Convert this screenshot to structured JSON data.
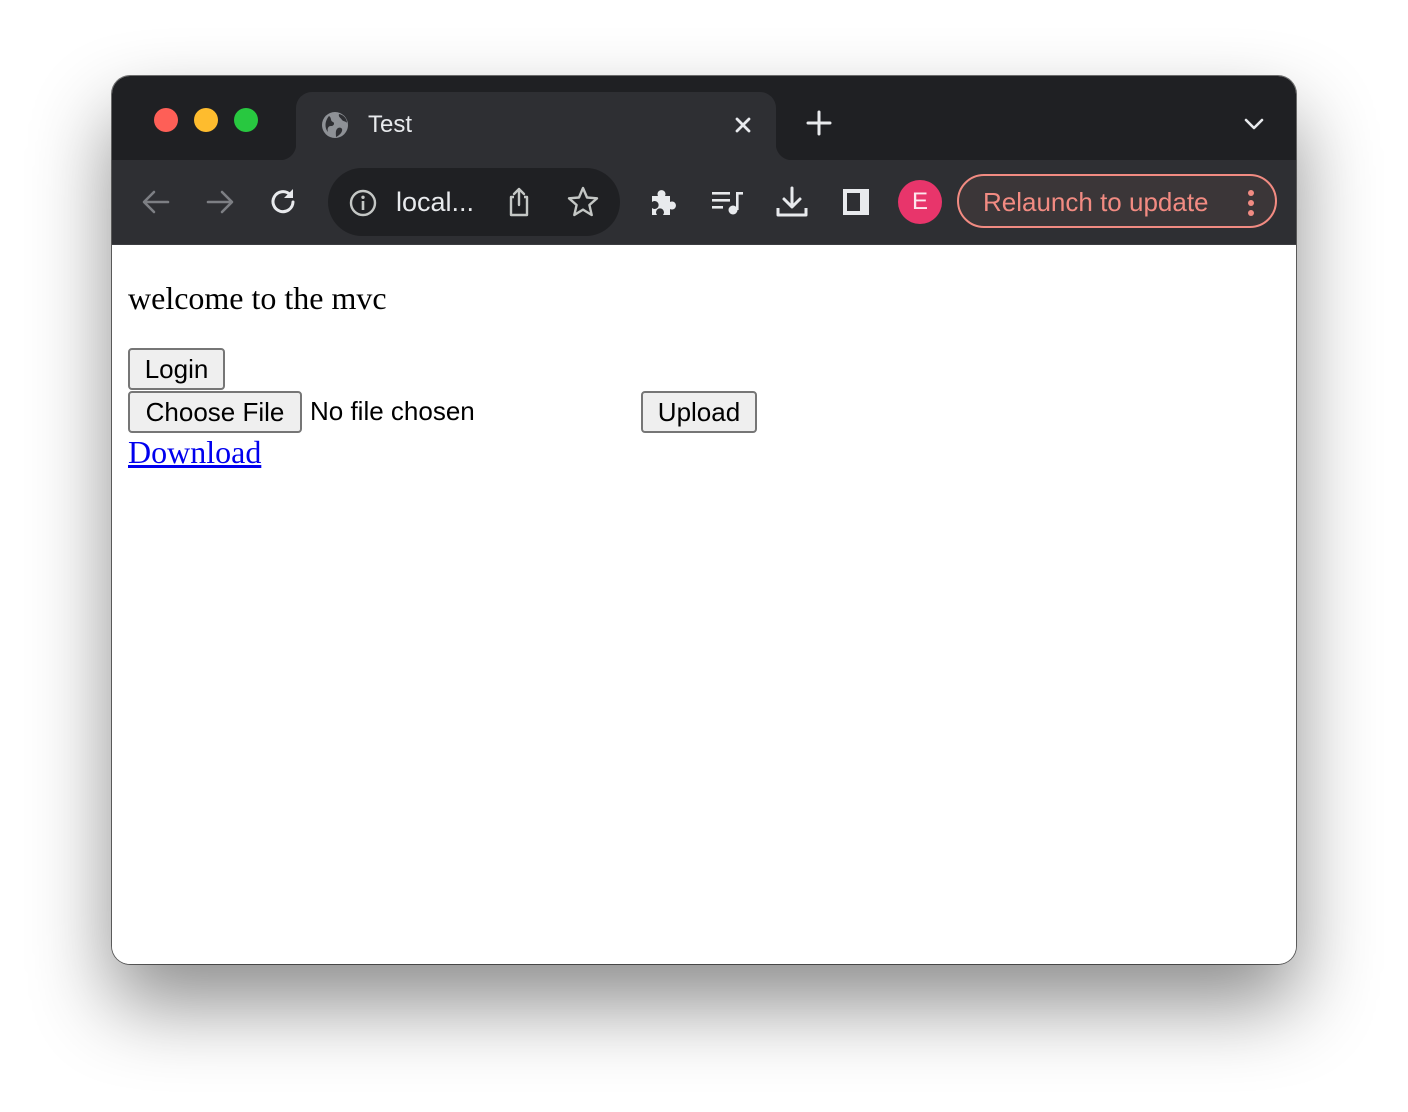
{
  "window": {
    "tab": {
      "title": "Test",
      "favicon": "globe-icon",
      "close_icon": "close-icon"
    },
    "new_tab_icon": "plus-icon",
    "tab_search_icon": "chevron-down-icon"
  },
  "toolbar": {
    "back_icon": "arrow-left-icon",
    "forward_icon": "arrow-right-icon",
    "reload_icon": "reload-icon",
    "omnibox": {
      "url_text": "local...",
      "info_icon": "info-icon",
      "share_icon": "share-icon",
      "bookmark_icon": "star-icon"
    },
    "extensions_icon": "puzzle-icon",
    "media_icon": "media-queue-icon",
    "downloads_icon": "download-icon",
    "side_panel_icon": "side-panel-icon",
    "profile_initial": "E",
    "relaunch_label": "Relaunch to update",
    "menu_icon": "kebab-menu-icon",
    "colors": {
      "avatar": "#e8356b",
      "relaunch": "#f28b82"
    }
  },
  "page": {
    "welcome_text": "welcome to the mvc",
    "login_label": "Login",
    "choose_file_label": "Choose File",
    "file_status": "No file chosen",
    "upload_label": "Upload",
    "download_link": "Download"
  }
}
